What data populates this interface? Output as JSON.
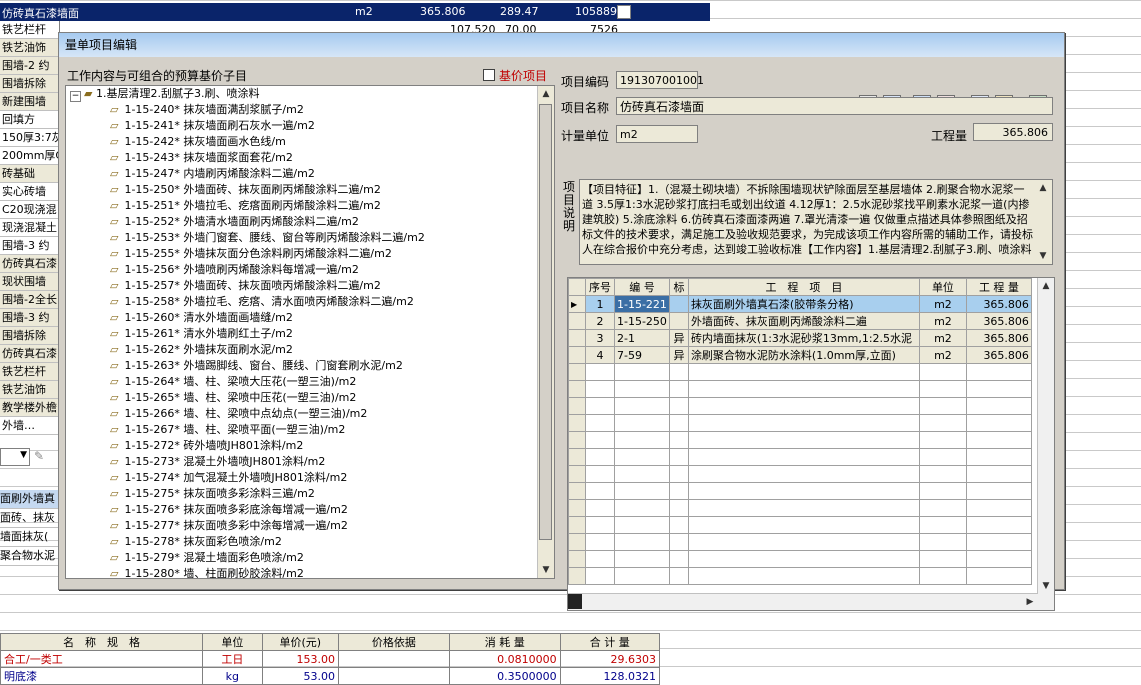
{
  "bg": {
    "selected_row": {
      "name": "仿砖真石漆墙面",
      "unit": "m2",
      "v1": "365.806",
      "v2": "289.47",
      "v3": "105889"
    },
    "second_row": {
      "name": "铁艺栏杆",
      "v1": "107.520",
      "v2": "70.00",
      "v3": "7526"
    },
    "left_items": [
      "铁艺油饰",
      "围墙-2 约",
      "围墙拆除",
      "新建围墙",
      "回填方",
      "150厚3:7灰",
      "200mm厚C20",
      "砖基础",
      "实心砖墙",
      "C20现浇混",
      "现浇混凝土",
      "围墙-3 约",
      "仿砖真石漆",
      "现状围墙",
      "围墙-2全长",
      "围墙-3 约",
      "围墙拆除",
      "仿砖真石漆",
      "铁艺栏杆",
      "铁艺油饰",
      "教学楼外檐",
      "外墙…"
    ],
    "mid_items": [
      "面刷外墙真",
      "面砖、抹灰",
      "墙面抹灰(",
      "聚合物水泥"
    ]
  },
  "bottom": {
    "headers": [
      "名　称　规　格",
      "单位",
      "单价(元)",
      "价格依据",
      "消 耗 量",
      "合 计 量"
    ],
    "rows": [
      {
        "name": "合工/一类工",
        "unit": "工日",
        "price": "153.00",
        "basis": "",
        "qty": "0.0810000",
        "total": "29.6303"
      },
      {
        "name": "明底漆",
        "unit": "kg",
        "price": "53.00",
        "basis": "",
        "qty": "0.3500000",
        "total": "128.0321"
      }
    ]
  },
  "dialog": {
    "title": "量单项目编辑",
    "left_title": "工作内容与可组合的预算基价子目",
    "checkbox_label": "基价项目",
    "tree_root": "1.基层清理2.刮腻子3.刷、喷涂料",
    "tree_items": [
      "1-15-240* 抹灰墙面满刮浆腻子/m2",
      "1-15-241* 抹灰墙面刷石灰水一遍/m2",
      "1-15-242* 抹灰墙面画水色线/m",
      "1-15-243* 抹灰墙面浆面套花/m2",
      "1-15-247* 内墙刷丙烯酸涂料二遍/m2",
      "1-15-250* 外墙面砖、抹灰面刷丙烯酸涂料二遍/m2",
      "1-15-251* 外墙拉毛、疙瘩面刷丙烯酸涂料二遍/m2",
      "1-15-252* 外墙清水墙面刷丙烯酸涂料二遍/m2",
      "1-15-253* 外墙门窗套、腰线、窗台等刷丙烯酸涂料二遍/m2",
      "1-15-255* 外墙抹灰面分色涂料刷丙烯酸涂料二遍/m2",
      "1-15-256* 外墙喷刷丙烯酸涂料每增减一遍/m2",
      "1-15-257* 外墙面砖、抹灰面喷丙烯酸涂料二遍/m2",
      "1-15-258* 外墙拉毛、疙瘩、清水面喷丙烯酸涂料二遍/m2",
      "1-15-260* 清水外墙面画墙缝/m2",
      "1-15-261* 清水外墙刷红土子/m2",
      "1-15-262* 外墙抹灰面刷水泥/m2",
      "1-15-263* 外墙踢脚线、窗台、腰线、门窗套刷水泥/m2",
      "1-15-264* 墙、柱、梁喷大压花(一塑三油)/m2",
      "1-15-265* 墙、柱、梁喷中压花(一塑三油)/m2",
      "1-15-266* 墙、柱、梁喷中点幼点(一塑三油)/m2",
      "1-15-267* 墙、柱、梁喷平面(一塑三油)/m2",
      "1-15-272* 砖外墙喷JH801涂料/m2",
      "1-15-273* 混凝土外墙喷JH801涂料/m2",
      "1-15-274* 加气混凝土外墙喷JH801涂料/m2",
      "1-15-275* 抹灰面喷多彩涂料三遍/m2",
      "1-15-276* 抹灰面喷多彩底涂每增减一遍/m2",
      "1-15-277* 抹灰面喷多彩中涂每增减一遍/m2",
      "1-15-278* 抹灰面彩色喷涂/m2",
      "1-15-279* 混凝土墙面彩色喷涂/m2",
      "1-15-280* 墙、柱面刷砂胶涂料/m2"
    ],
    "labels": {
      "code": "项目编码",
      "name": "项目名称",
      "unit": "计量单位",
      "qty": "工程量",
      "desc": "项目说明"
    },
    "values": {
      "code": "191307001001",
      "name": "仿砖真石漆墙面",
      "unit": "m2",
      "qty": "365.806"
    },
    "description": "【项目特征】1.（混凝土砌块墙）不拆除围墙现状铲除面层至基层墙体 2.刷聚合物水泥浆一道 3.5厚1:3水泥砂浆打底扫毛或划出纹道 4.12厚1：2.5水泥砂浆找平刷素水泥浆一道(内掺建筑胶) 5.涂底涂料 6.仿砖真石漆面漆两遍 7.罩光清漆一遍 仅做重点描述具体参照图纸及招标文件的技术要求，满足施工及验收规范要求，为完成该项工作内容所需的辅助工作，请投标人在综合报价中充分考虑，达到竣工验收标准【工作内容】1.基层清理2.刮腻子3.刷、喷涂料",
    "grid_headers": [
      "序号",
      "编 号",
      "标",
      "工　程　项　目",
      "单位",
      "工 程 量"
    ],
    "grid_rows": [
      {
        "seq": "1",
        "code": "1-15-221",
        "flag": "",
        "item": "抹灰面刷外墙真石漆(胶带条分格)",
        "unit": "m2",
        "qty": "365.806"
      },
      {
        "seq": "2",
        "code": "1-15-250",
        "flag": "",
        "item": "外墙面砖、抹灰面刷丙烯酸涂料二遍",
        "unit": "m2",
        "qty": "365.806"
      },
      {
        "seq": "3",
        "code": "2-1",
        "flag": "异",
        "item": "砖内墙面抹灰(1:3水泥砂浆13mm,1:2.5水泥",
        "unit": "m2",
        "qty": "365.806"
      },
      {
        "seq": "4",
        "code": "7-59",
        "flag": "异",
        "item": "涂刷聚合物水泥防水涂料(1.0mm厚,立面)",
        "unit": "m2",
        "qty": "365.806"
      }
    ],
    "toolbar_icons": [
      "calculator-icon",
      "table-icon",
      "import-icon",
      "edit-pen-icon",
      "form-icon",
      "grid-window-icon",
      "exit-door-icon"
    ]
  }
}
